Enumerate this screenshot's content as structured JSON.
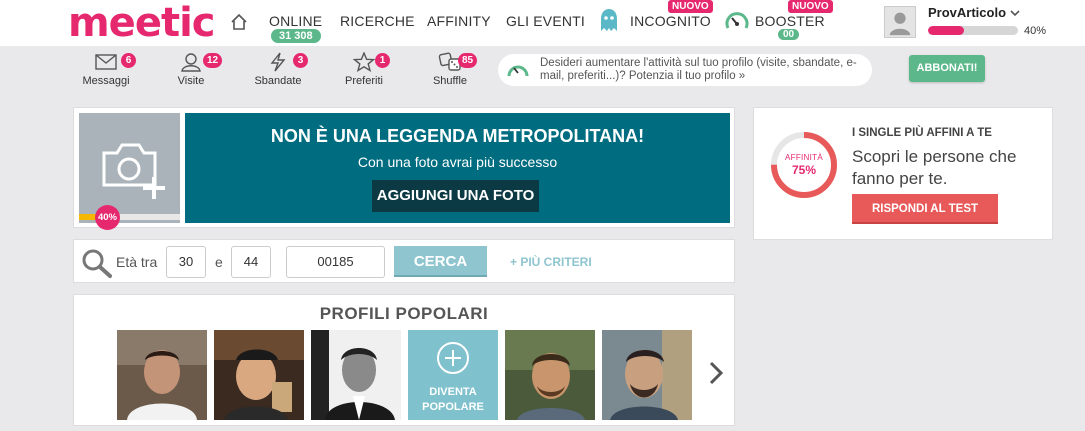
{
  "logo": {
    "text_m": "me",
    "text_rest": "etic"
  },
  "nav": {
    "online_label": "ONLINE",
    "online_count": "31 308",
    "ricerche_label": "RICERCHE",
    "affinity_label": "AFFINITY",
    "eventi_label": "GLI EVENTI",
    "incognito_label": "INCOGNITO",
    "incognito_badge": "NUOVO",
    "booster_label": "BOOSTER",
    "booster_badge": "NUOVO",
    "booster_count": "00"
  },
  "user": {
    "name": "ProvArticolo",
    "profile_completion": 40,
    "profile_completion_label": "40%"
  },
  "subnav": {
    "items": [
      {
        "label": "Messaggi",
        "badge": "6",
        "icon": "envelope-icon"
      },
      {
        "label": "Visite",
        "badge": "12",
        "icon": "user-icon"
      },
      {
        "label": "Sbandate",
        "badge": "3",
        "icon": "lightning-icon"
      },
      {
        "label": "Preferiti",
        "badge": "1",
        "icon": "star-icon"
      },
      {
        "label": "Shuffle",
        "badge": "85",
        "icon": "dice-icon"
      }
    ]
  },
  "promo": {
    "text": "Desideri aumentare l'attività sul tuo profilo (visite, sbandate, e-mail, preferiti...)? Potenzia il tuo profilo »"
  },
  "abbonati_label": "ABBONATI!",
  "photo_banner": {
    "title": "NON È UNA LEGGENDA METROPOLITANA!",
    "subtitle": "Con una foto avrai più successo",
    "button": "AGGIUNGI UNA FOTO",
    "progress": 40,
    "progress_label": "40%"
  },
  "search": {
    "age_label": "Età tra",
    "age_min": "30",
    "and_label": "e",
    "age_max": "44",
    "postal_code": "00185",
    "button": "CERCA",
    "more_criteria": "+ PIÙ CRITERI"
  },
  "popular": {
    "title": "PROFILI POPOLARI",
    "diventa_line1": "DIVENTA",
    "diventa_line2": "POPOLARE"
  },
  "affinity": {
    "ring_label": "AFFINITÀ",
    "ring_pct": "75%",
    "ring_value": 75,
    "heading": "I SINGLE PIÙ AFFINI A TE",
    "text": "Scopri le persone che fanno per te.",
    "button": "RISPONDI AL TEST"
  },
  "colors": {
    "brand": "#e6286f",
    "green": "#5cb88a",
    "teal": "#006c80",
    "coral": "#e85a5a"
  }
}
